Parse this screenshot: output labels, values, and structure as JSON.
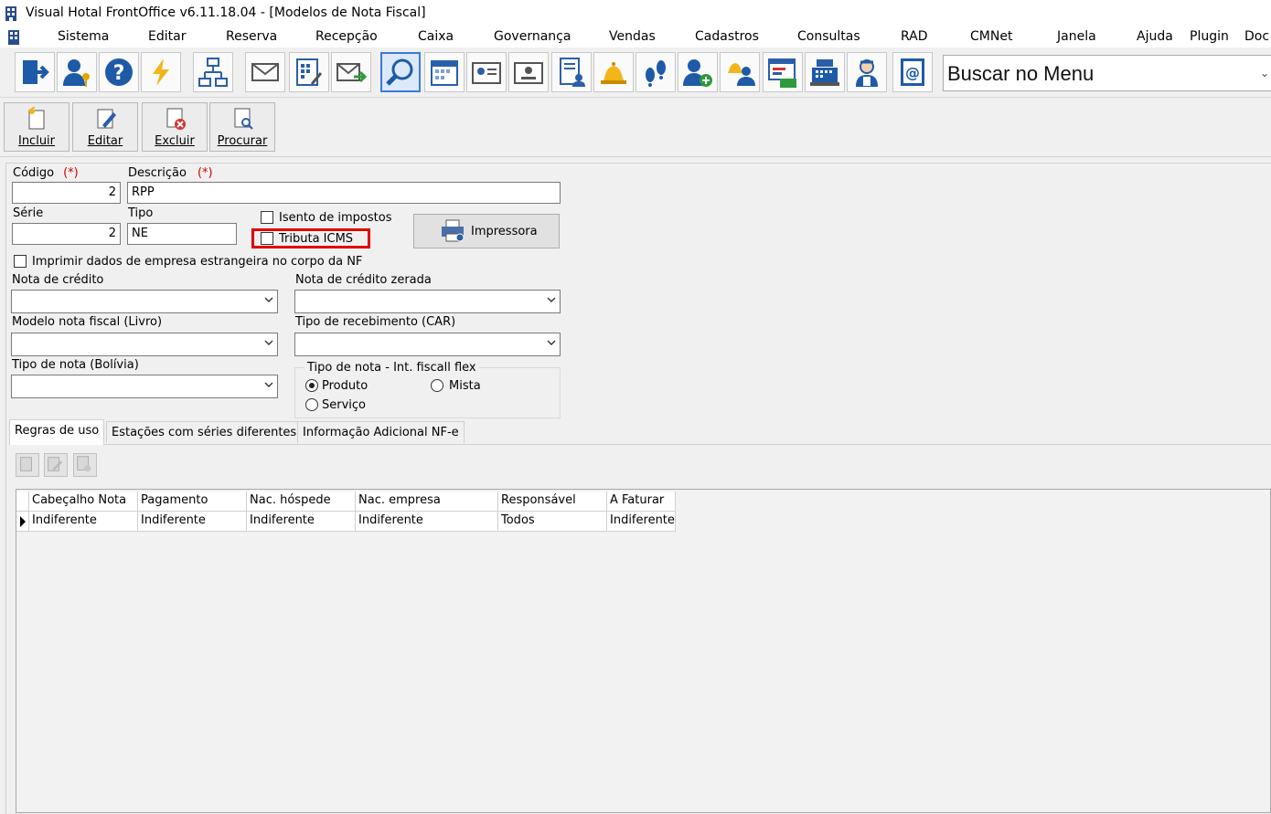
{
  "window": {
    "title": "Visual Hotal FrontOffice v6.11.18.04 - [Modelos de Nota Fiscal]"
  },
  "menu": [
    "Sistema",
    "Editar",
    "Reserva",
    "Recepção",
    "Caixa",
    "Governança",
    "Vendas",
    "Cadastros",
    "Consultas",
    "RAD",
    "CMNet",
    "Janela",
    "Ajuda",
    "Plugin",
    "Doc"
  ],
  "toolbar": {
    "icons": [
      "exit-icon",
      "user-key-icon",
      "help-icon",
      "lightning-icon",
      "org-chart-icon",
      "mail-icon",
      "calculator-doc-icon",
      "mail-forward-icon",
      "search-icon",
      "calendar-icon",
      "id-card-icon",
      "id-card-alt-icon",
      "report-user-icon",
      "bell-icon",
      "footprints-icon",
      "add-user-icon",
      "bell-users-icon",
      "chart-money-icon",
      "cash-register-icon",
      "maid-icon",
      "email-book-icon"
    ],
    "search_placeholder": "Buscar no Menu"
  },
  "actions": {
    "incluir": "Incluir",
    "editar": "Editar",
    "excluir": "Excluir",
    "procurar": "Procurar"
  },
  "form": {
    "codigo_label": "Código",
    "required_mark": "(*)",
    "codigo_value": "2",
    "descricao_label": "Descrição",
    "descricao_value": "RPP",
    "serie_label": "Série",
    "serie_value": "2",
    "tipo_label": "Tipo",
    "tipo_value": "NE",
    "isento_label": "Isento de impostos",
    "isento_checked": false,
    "tributa_label": "Tributa ICMS",
    "tributa_checked": false,
    "impressora_label": "Impressora",
    "imprimir_label": "Imprimir dados de empresa estrangeira no corpo da NF",
    "imprimir_checked": false,
    "nota_credito_label": "Nota de crédito",
    "nota_credito_value": "",
    "nota_credito_zerada_label": "Nota de crédito zerada",
    "nota_credito_zerada_value": "",
    "modelo_label": "Modelo nota fiscal (Livro)",
    "modelo_value": "",
    "tipo_receb_label": "Tipo de recebimento (CAR)",
    "tipo_receb_value": "",
    "tipo_bolivia_label": "Tipo de nota (Bolívia)",
    "tipo_bolivia_value": "",
    "flex_group_label": "Tipo de nota - Int. fiscall flex",
    "flex_options": [
      "Produto",
      "Mista",
      "Serviço"
    ],
    "flex_selected": "Produto"
  },
  "tabs": [
    "Regras de uso",
    "Estações com séries diferentes",
    "Informação Adicional NF-e"
  ],
  "grid": {
    "headers": [
      "Cabeçalho Nota",
      "Pagamento",
      "Nac. hóspede",
      "Nac. empresa",
      "Responsável",
      "A Faturar"
    ],
    "rows": [
      [
        "Indiferente",
        "Indiferente",
        "Indiferente",
        "Indiferente",
        "Todos",
        "Indiferente"
      ]
    ]
  },
  "colors": {
    "highlight": "#e00000",
    "active_toolbar": "#3a7ad8"
  }
}
